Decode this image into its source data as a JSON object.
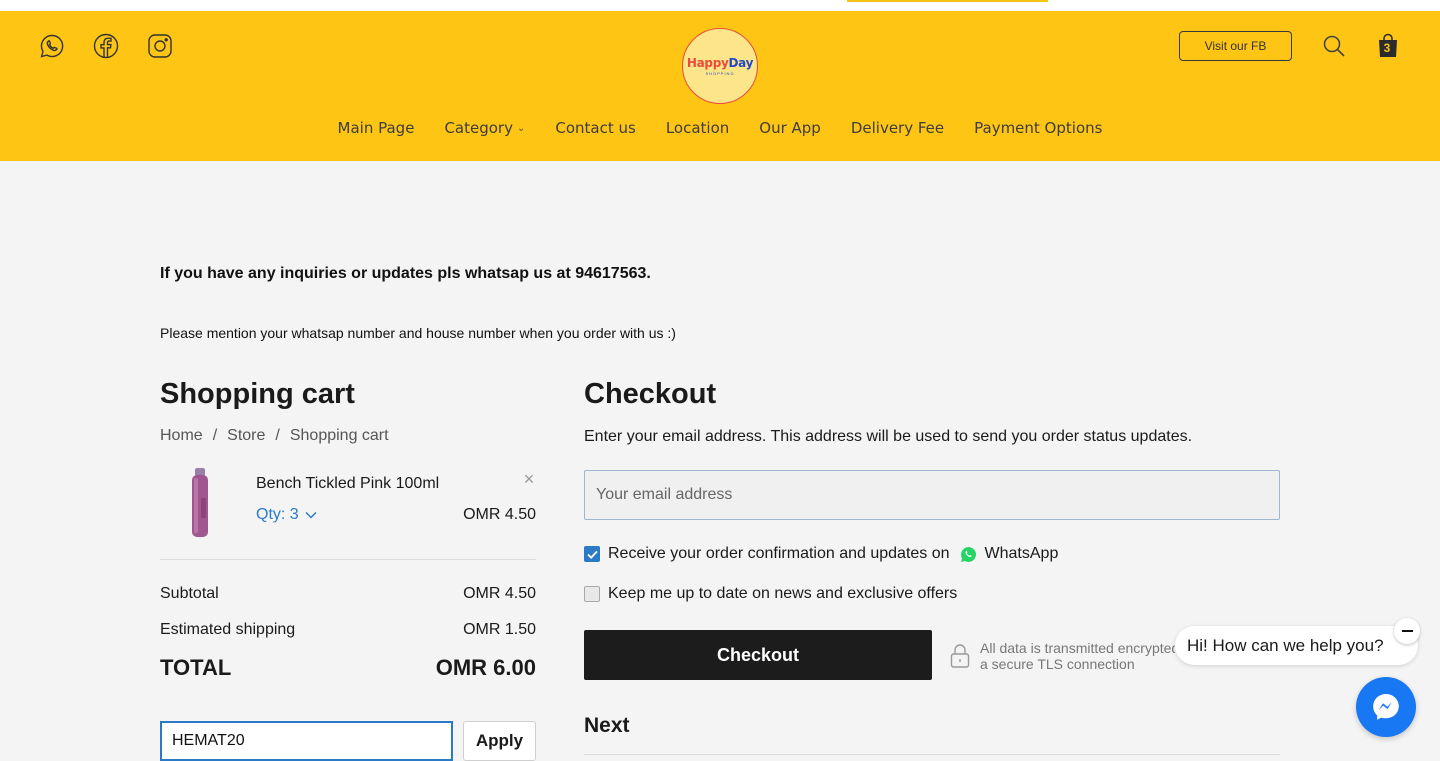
{
  "header": {
    "social": [
      "whatsapp-icon",
      "facebook-icon",
      "instagram-icon"
    ],
    "logo": {
      "brand_happy": "Happy",
      "brand_day": "Day",
      "sub": "SHOPPING"
    },
    "fb_button": "Visit our FB",
    "cart_count": "3",
    "nav": [
      {
        "label": "Main Page"
      },
      {
        "label": "Category"
      },
      {
        "label": "Contact us"
      },
      {
        "label": "Location"
      },
      {
        "label": "Our App"
      },
      {
        "label": "Delivery Fee"
      },
      {
        "label": "Payment Options"
      }
    ],
    "colors": {
      "bar": "#fec515"
    }
  },
  "notices": {
    "line1": "If you have any inquiries or updates pls whatsap us at 94617563.",
    "line2": "Please mention your whatsap number and house number when you order with us :)"
  },
  "cart": {
    "title": "Shopping cart",
    "breadcrumb": [
      "Home",
      "Store",
      "Shopping cart"
    ],
    "item": {
      "name": "Bench Tickled Pink 100ml",
      "qty": "Qty: 3",
      "price": "OMR 4.50"
    },
    "subtotal_label": "Subtotal",
    "subtotal_value": "OMR 4.50",
    "shipping_label": "Estimated shipping",
    "shipping_value": "OMR 1.50",
    "total_label": "TOTAL",
    "total_value": "OMR 6.00",
    "coupon_value": "HEMAT20",
    "apply_label": "Apply"
  },
  "checkout": {
    "title": "Checkout",
    "description": "Enter your email address. This address will be used to send you order status updates.",
    "email_placeholder": "Your email address",
    "whatsapp_opt_label": "Receive your order confirmation and updates on",
    "whatsapp_word": "WhatsApp",
    "whatsapp_checked": true,
    "news_opt_label": "Keep me up to date on news and exclusive offers",
    "news_checked": false,
    "button": "Checkout",
    "secure_text": "All data is transmitted encrypted via a secure TLS connection",
    "next_title": "Next"
  },
  "chat": {
    "greeting": "Hi! How can we help you?"
  }
}
